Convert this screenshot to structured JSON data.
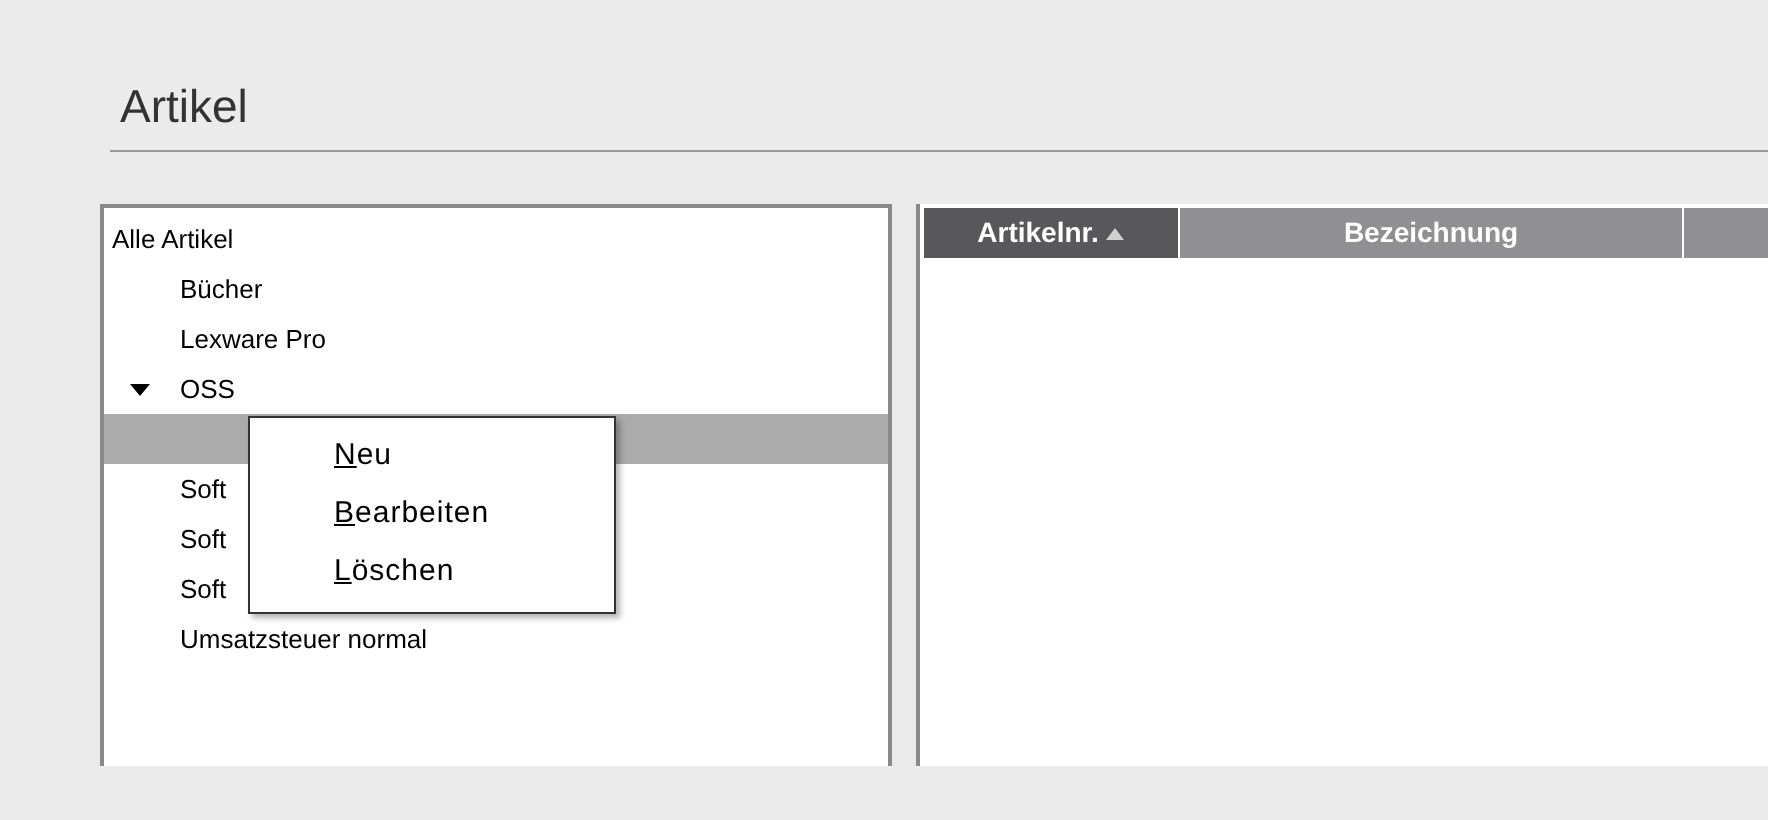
{
  "page": {
    "title": "Artikel"
  },
  "tree": [
    {
      "label": "Alle Artikel",
      "selected": false,
      "children": [
        {
          "label": "Bücher",
          "selected": false
        },
        {
          "label": "Lexware Pro",
          "selected": false
        },
        {
          "label": "OSS",
          "selected": false,
          "expanded": true,
          "children": [
            {
              "selected": true
            }
          ]
        },
        {
          "label": "Soft",
          "selected": false
        },
        {
          "label": "Soft",
          "selected": false
        },
        {
          "label": "Soft",
          "selected": false
        },
        {
          "label": "Umsatzsteuer normal",
          "selected": false
        }
      ]
    }
  ],
  "context_menu": [
    {
      "label": "Neu"
    },
    {
      "label": "Bearbeiten"
    },
    {
      "label": "Löschen"
    }
  ],
  "table": {
    "columns": [
      {
        "label": "Artikelnr.",
        "sorted": true
      },
      {
        "label": "Bezeichnung"
      }
    ]
  }
}
